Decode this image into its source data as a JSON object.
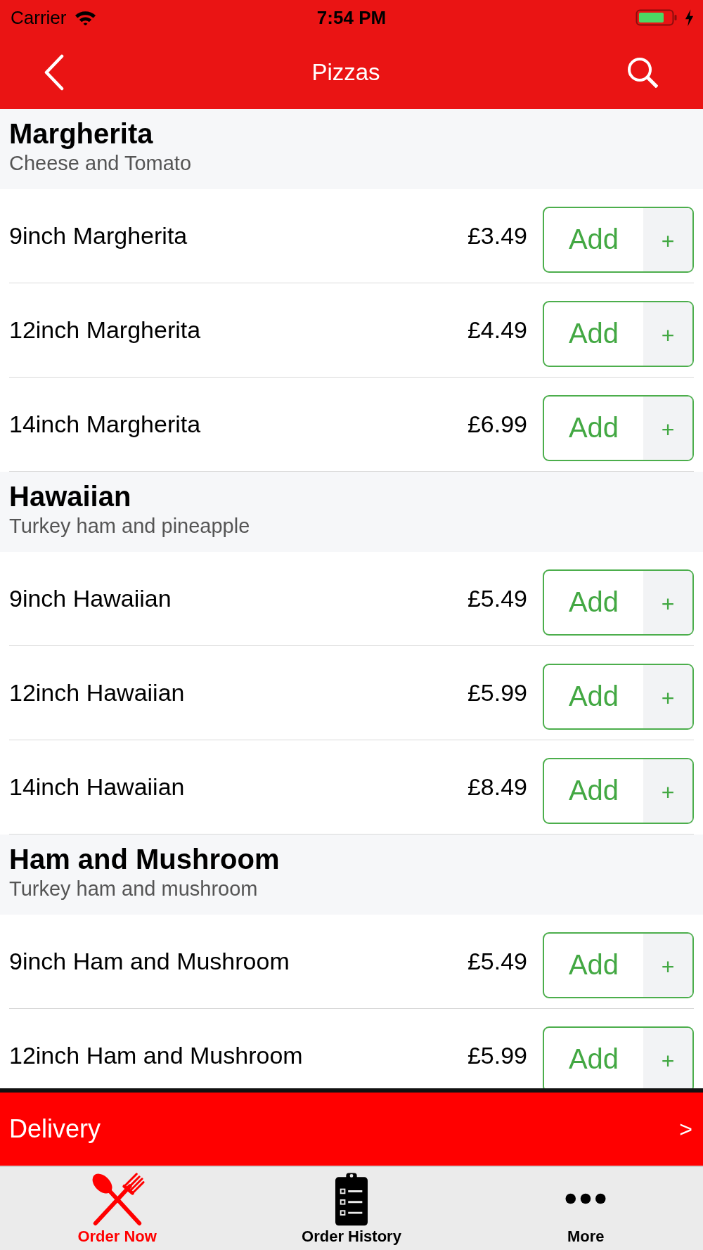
{
  "status_bar": {
    "carrier": "Carrier",
    "time": "7:54 PM"
  },
  "nav_bar": {
    "title": "Pizzas"
  },
  "sections": [
    {
      "title": "Margherita",
      "subtitle": "Cheese and Tomato",
      "items": [
        {
          "name": "9inch Margherita",
          "price": "£3.49",
          "button": "Add",
          "plus": "+"
        },
        {
          "name": "12inch Margherita",
          "price": "£4.49",
          "button": "Add",
          "plus": "+"
        },
        {
          "name": "14inch Margherita",
          "price": "£6.99",
          "button": "Add",
          "plus": "+"
        }
      ]
    },
    {
      "title": "Hawaiian",
      "subtitle": "Turkey ham and pineapple",
      "items": [
        {
          "name": "9inch Hawaiian",
          "price": "£5.49",
          "button": "Add",
          "plus": "+"
        },
        {
          "name": "12inch Hawaiian",
          "price": "£5.99",
          "button": "Add",
          "plus": "+"
        },
        {
          "name": "14inch Hawaiian",
          "price": "£8.49",
          "button": "Add",
          "plus": "+"
        }
      ]
    },
    {
      "title": "Ham and Mushroom",
      "subtitle": "Turkey ham and mushroom",
      "items": [
        {
          "name": "9inch Ham and Mushroom",
          "price": "£5.49",
          "button": "Add",
          "plus": "+"
        },
        {
          "name": "12inch Ham and Mushroom",
          "price": "£5.99",
          "button": "Add",
          "plus": "+"
        }
      ]
    }
  ],
  "delivery_bar": {
    "label": "Delivery",
    "arrow": ">"
  },
  "tab_bar": [
    {
      "label": "Order Now",
      "selected": true
    },
    {
      "label": "Order History",
      "selected": false
    },
    {
      "label": "More",
      "selected": false
    }
  ]
}
